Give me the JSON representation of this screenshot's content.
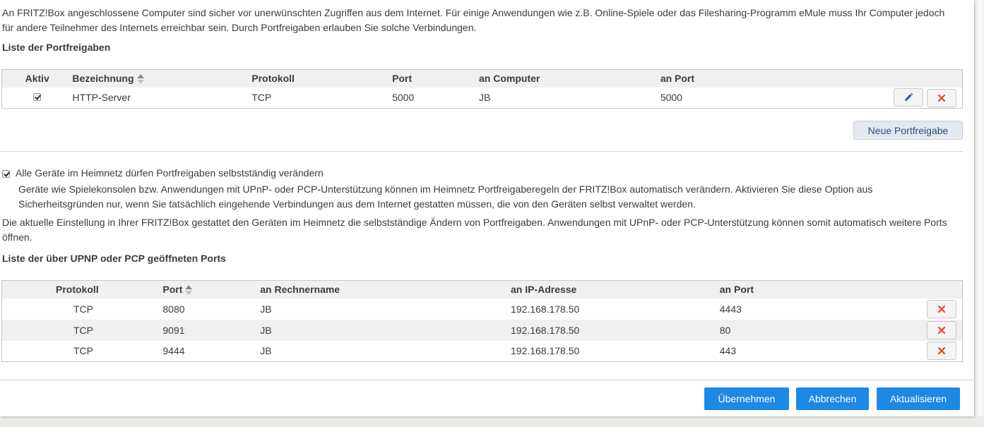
{
  "intro_text": "An FRITZ!Box angeschlossene Computer sind sicher vor unerwünschten Zugriffen aus dem Internet. Für einige Anwendungen wie z.B. Online-Spiele oder das Filesharing-Programm eMule muss Ihr Computer jedoch für andere Teilnehmer des Internets erreichbar sein. Durch Portfreigaben erlauben Sie solche Verbindungen.",
  "portfreigaben": {
    "heading": "Liste der Portfreigaben",
    "columns": {
      "aktiv": "Aktiv",
      "bezeichnung": "Bezeichnung",
      "protokoll": "Protokoll",
      "port": "Port",
      "an_computer": "an Computer",
      "an_port": "an Port"
    },
    "rows": [
      {
        "aktiv": true,
        "bezeichnung": "HTTP-Server",
        "protokoll": "TCP",
        "port": "5000",
        "an_computer": "JB",
        "an_port": "5000"
      }
    ],
    "new_button": "Neue Portfreigabe"
  },
  "upnp_option": {
    "checked": true,
    "label": "Alle Geräte im Heimnetz dürfen Portfreigaben selbstständig verändern",
    "description": "Geräte wie Spielekonsolen bzw. Anwendungen mit UPnP- oder PCP-Unterstützung können im Heimnetz Portfreigaberegeln der FRITZ!Box automatisch verändern. Aktivieren Sie diese Option aus Sicherheitsgründen nur, wenn Sie tatsächlich eingehende Verbindungen aus dem Internet gestatten müssen, die von den Geräten selbst verwaltet werden."
  },
  "current_setting_text": "Die aktuelle Einstellung in Ihrer FRITZ!Box gestattet den Geräten im Heimnetz die selbstständige Ändern von Portfreigaben. Anwendungen mit UPnP- oder PCP-Unterstützung können somit automatisch weitere Ports öffnen.",
  "upnp_ports": {
    "heading": "Liste der über UPNP oder PCP geöffneten Ports",
    "columns": {
      "protokoll": "Protokoll",
      "port": "Port",
      "an_rechnername": "an Rechnername",
      "an_ip": "an IP-Adresse",
      "an_port": "an Port"
    },
    "rows": [
      {
        "protokoll": "TCP",
        "port": "8080",
        "rechner": "JB",
        "ip": "192.168.178.50",
        "an_port": "4443"
      },
      {
        "protokoll": "TCP",
        "port": "9091",
        "rechner": "JB",
        "ip": "192.168.178.50",
        "an_port": "80"
      },
      {
        "protokoll": "TCP",
        "port": "9444",
        "rechner": "JB",
        "ip": "192.168.178.50",
        "an_port": "443"
      }
    ]
  },
  "buttons": {
    "apply": "Übernehmen",
    "cancel": "Abbrechen",
    "refresh": "Aktualisieren"
  },
  "colors": {
    "primary": "#1e88e5",
    "delete_icon": "#e8451e",
    "edit_icon": "#2f5b9b"
  },
  "icons": {
    "edit": "pencil-icon",
    "delete": "close-x-icon",
    "sort": "sort-arrows-icon"
  }
}
